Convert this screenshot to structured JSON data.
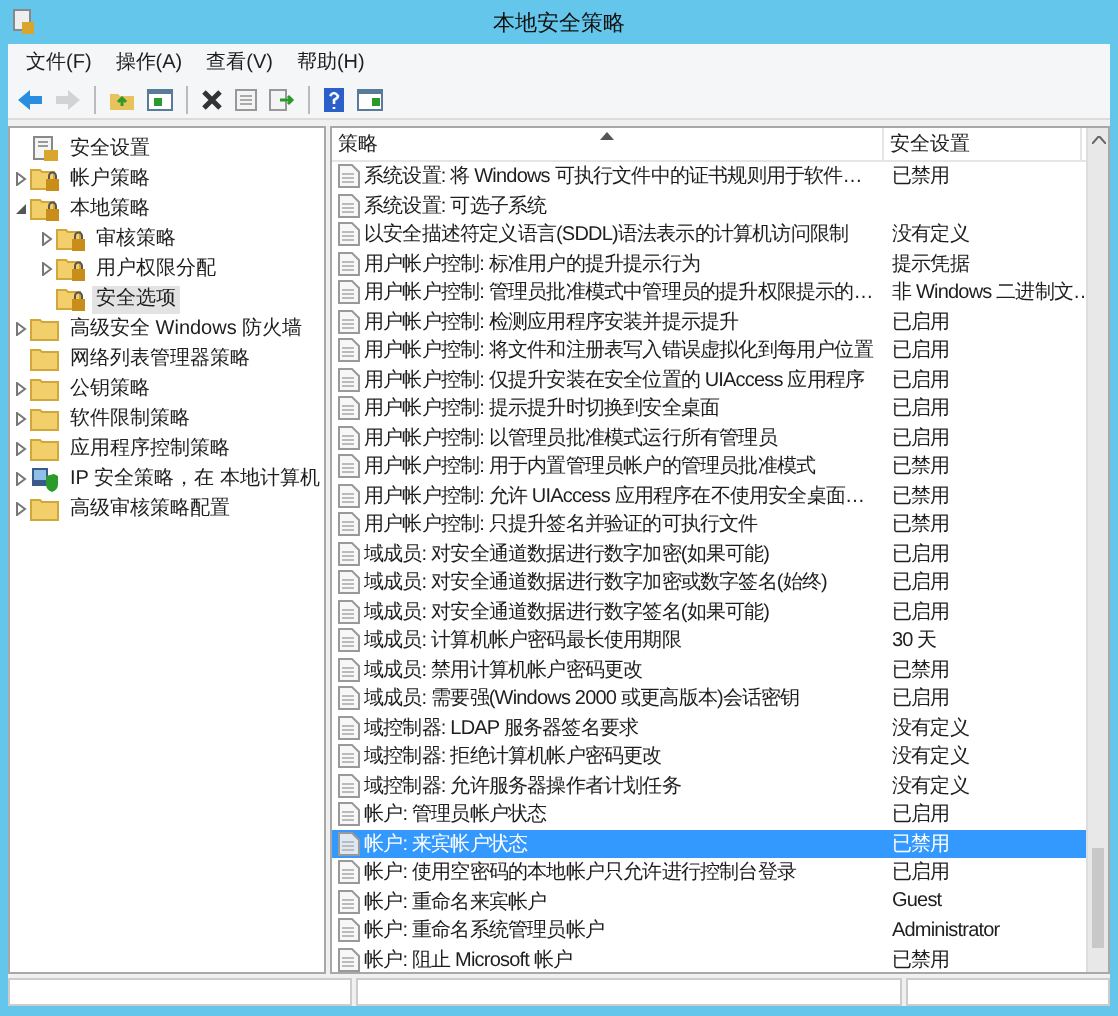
{
  "window": {
    "title": "本地安全策略"
  },
  "menu": [
    "文件(F)",
    "操作(A)",
    "查看(V)",
    "帮助(H)"
  ],
  "toolbar": [
    {
      "kind": "back",
      "disabled": false
    },
    {
      "kind": "forward",
      "disabled": true
    },
    {
      "kind": "up",
      "disabled": false
    },
    {
      "kind": "tree",
      "disabled": false
    },
    {
      "kind": "delete",
      "disabled": false
    },
    {
      "kind": "properties",
      "disabled": false
    },
    {
      "kind": "export",
      "disabled": false
    },
    {
      "kind": "help",
      "disabled": false
    },
    {
      "kind": "panel",
      "disabled": false
    }
  ],
  "tree": {
    "items": [
      {
        "label": "安全设置",
        "kind": "root",
        "selected": false,
        "children": [
          {
            "label": "帐户策略",
            "kind": "locked-folder",
            "selected": false,
            "expanded": false
          },
          {
            "label": "本地策略",
            "kind": "locked-folder",
            "selected": false,
            "expanded": true,
            "children": [
              {
                "label": "审核策略",
                "kind": "locked-folder",
                "selected": false,
                "expanded": false
              },
              {
                "label": "用户权限分配",
                "kind": "locked-folder",
                "selected": false,
                "expanded": false
              },
              {
                "label": "安全选项",
                "kind": "locked-folder",
                "selected": true
              }
            ]
          },
          {
            "label": "高级安全 Windows 防火墙",
            "kind": "folder",
            "selected": false,
            "expanded": false
          },
          {
            "label": "网络列表管理器策略",
            "kind": "folder",
            "selected": false
          },
          {
            "label": "公钥策略",
            "kind": "folder",
            "selected": false,
            "expanded": false
          },
          {
            "label": "软件限制策略",
            "kind": "folder",
            "selected": false,
            "expanded": false
          },
          {
            "label": "应用程序控制策略",
            "kind": "folder",
            "selected": false,
            "expanded": false
          },
          {
            "label": "IP 安全策略，在 本地计算机",
            "kind": "ip-policy",
            "selected": false,
            "expanded": false
          },
          {
            "label": "高级审核策略配置",
            "kind": "folder",
            "selected": false,
            "expanded": false
          }
        ]
      }
    ]
  },
  "table": {
    "columns": [
      {
        "label": "策略",
        "sorted": true
      },
      {
        "label": "安全设置",
        "sorted": false
      }
    ],
    "rows": [
      {
        "policy": "系统设置: 将 Windows 可执行文件中的证书规则用于软件…",
        "setting": "已禁用",
        "selected": false
      },
      {
        "policy": "系统设置: 可选子系统",
        "selected": false
      },
      {
        "policy": "以安全描述符定义语言(SDDL)语法表示的计算机访问限制",
        "setting": "没有定义",
        "selected": false
      },
      {
        "policy": "用户帐户控制: 标准用户的提升提示行为",
        "setting": "提示凭据",
        "selected": false
      },
      {
        "policy": "用户帐户控制: 管理员批准模式中管理员的提升权限提示的…",
        "setting": "非 Windows 二进制文…",
        "selected": false
      },
      {
        "policy": "用户帐户控制: 检测应用程序安装并提示提升",
        "setting": "已启用",
        "selected": false
      },
      {
        "policy": "用户帐户控制: 将文件和注册表写入错误虚拟化到每用户位置",
        "setting": "已启用",
        "selected": false
      },
      {
        "policy": "用户帐户控制: 仅提升安装在安全位置的 UIAccess 应用程序",
        "setting": "已启用",
        "selected": false
      },
      {
        "policy": "用户帐户控制: 提示提升时切换到安全桌面",
        "setting": "已启用",
        "selected": false
      },
      {
        "policy": "用户帐户控制: 以管理员批准模式运行所有管理员",
        "setting": "已启用",
        "selected": false
      },
      {
        "policy": "用户帐户控制: 用于内置管理员帐户的管理员批准模式",
        "setting": "已禁用",
        "selected": false
      },
      {
        "policy": "用户帐户控制: 允许 UIAccess 应用程序在不使用安全桌面…",
        "setting": "已禁用",
        "selected": false
      },
      {
        "policy": "用户帐户控制: 只提升签名并验证的可执行文件",
        "setting": "已禁用",
        "selected": false
      },
      {
        "policy": "域成员: 对安全通道数据进行数字加密(如果可能)",
        "setting": "已启用",
        "selected": false
      },
      {
        "policy": "域成员: 对安全通道数据进行数字加密或数字签名(始终)",
        "setting": "已启用",
        "selected": false
      },
      {
        "policy": "域成员: 对安全通道数据进行数字签名(如果可能)",
        "setting": "已启用",
        "selected": false
      },
      {
        "policy": "域成员: 计算机帐户密码最长使用期限",
        "setting": "30 天",
        "selected": false
      },
      {
        "policy": "域成员: 禁用计算机帐户密码更改",
        "setting": "已禁用",
        "selected": false
      },
      {
        "policy": "域成员: 需要强(Windows 2000 或更高版本)会话密钥",
        "setting": "已启用",
        "selected": false
      },
      {
        "policy": "域控制器: LDAP 服务器签名要求",
        "setting": "没有定义",
        "selected": false
      },
      {
        "policy": "域控制器: 拒绝计算机帐户密码更改",
        "setting": "没有定义",
        "selected": false
      },
      {
        "policy": "域控制器: 允许服务器操作者计划任务",
        "setting": "没有定义",
        "selected": false
      },
      {
        "policy": "帐户: 管理员帐户状态",
        "setting": "已启用",
        "selected": false
      },
      {
        "policy": "帐户: 来宾帐户状态",
        "setting": "已禁用",
        "selected": true
      },
      {
        "policy": "帐户: 使用空密码的本地帐户只允许进行控制台登录",
        "setting": "已启用",
        "selected": false
      },
      {
        "policy": "帐户: 重命名来宾帐户",
        "setting": "Guest",
        "selected": false
      },
      {
        "policy": "帐户: 重命名系统管理员帐户",
        "setting": "Administrator",
        "selected": false
      },
      {
        "policy": "帐户: 阻止 Microsoft 帐户",
        "setting": "已禁用",
        "selected": false
      }
    ]
  }
}
